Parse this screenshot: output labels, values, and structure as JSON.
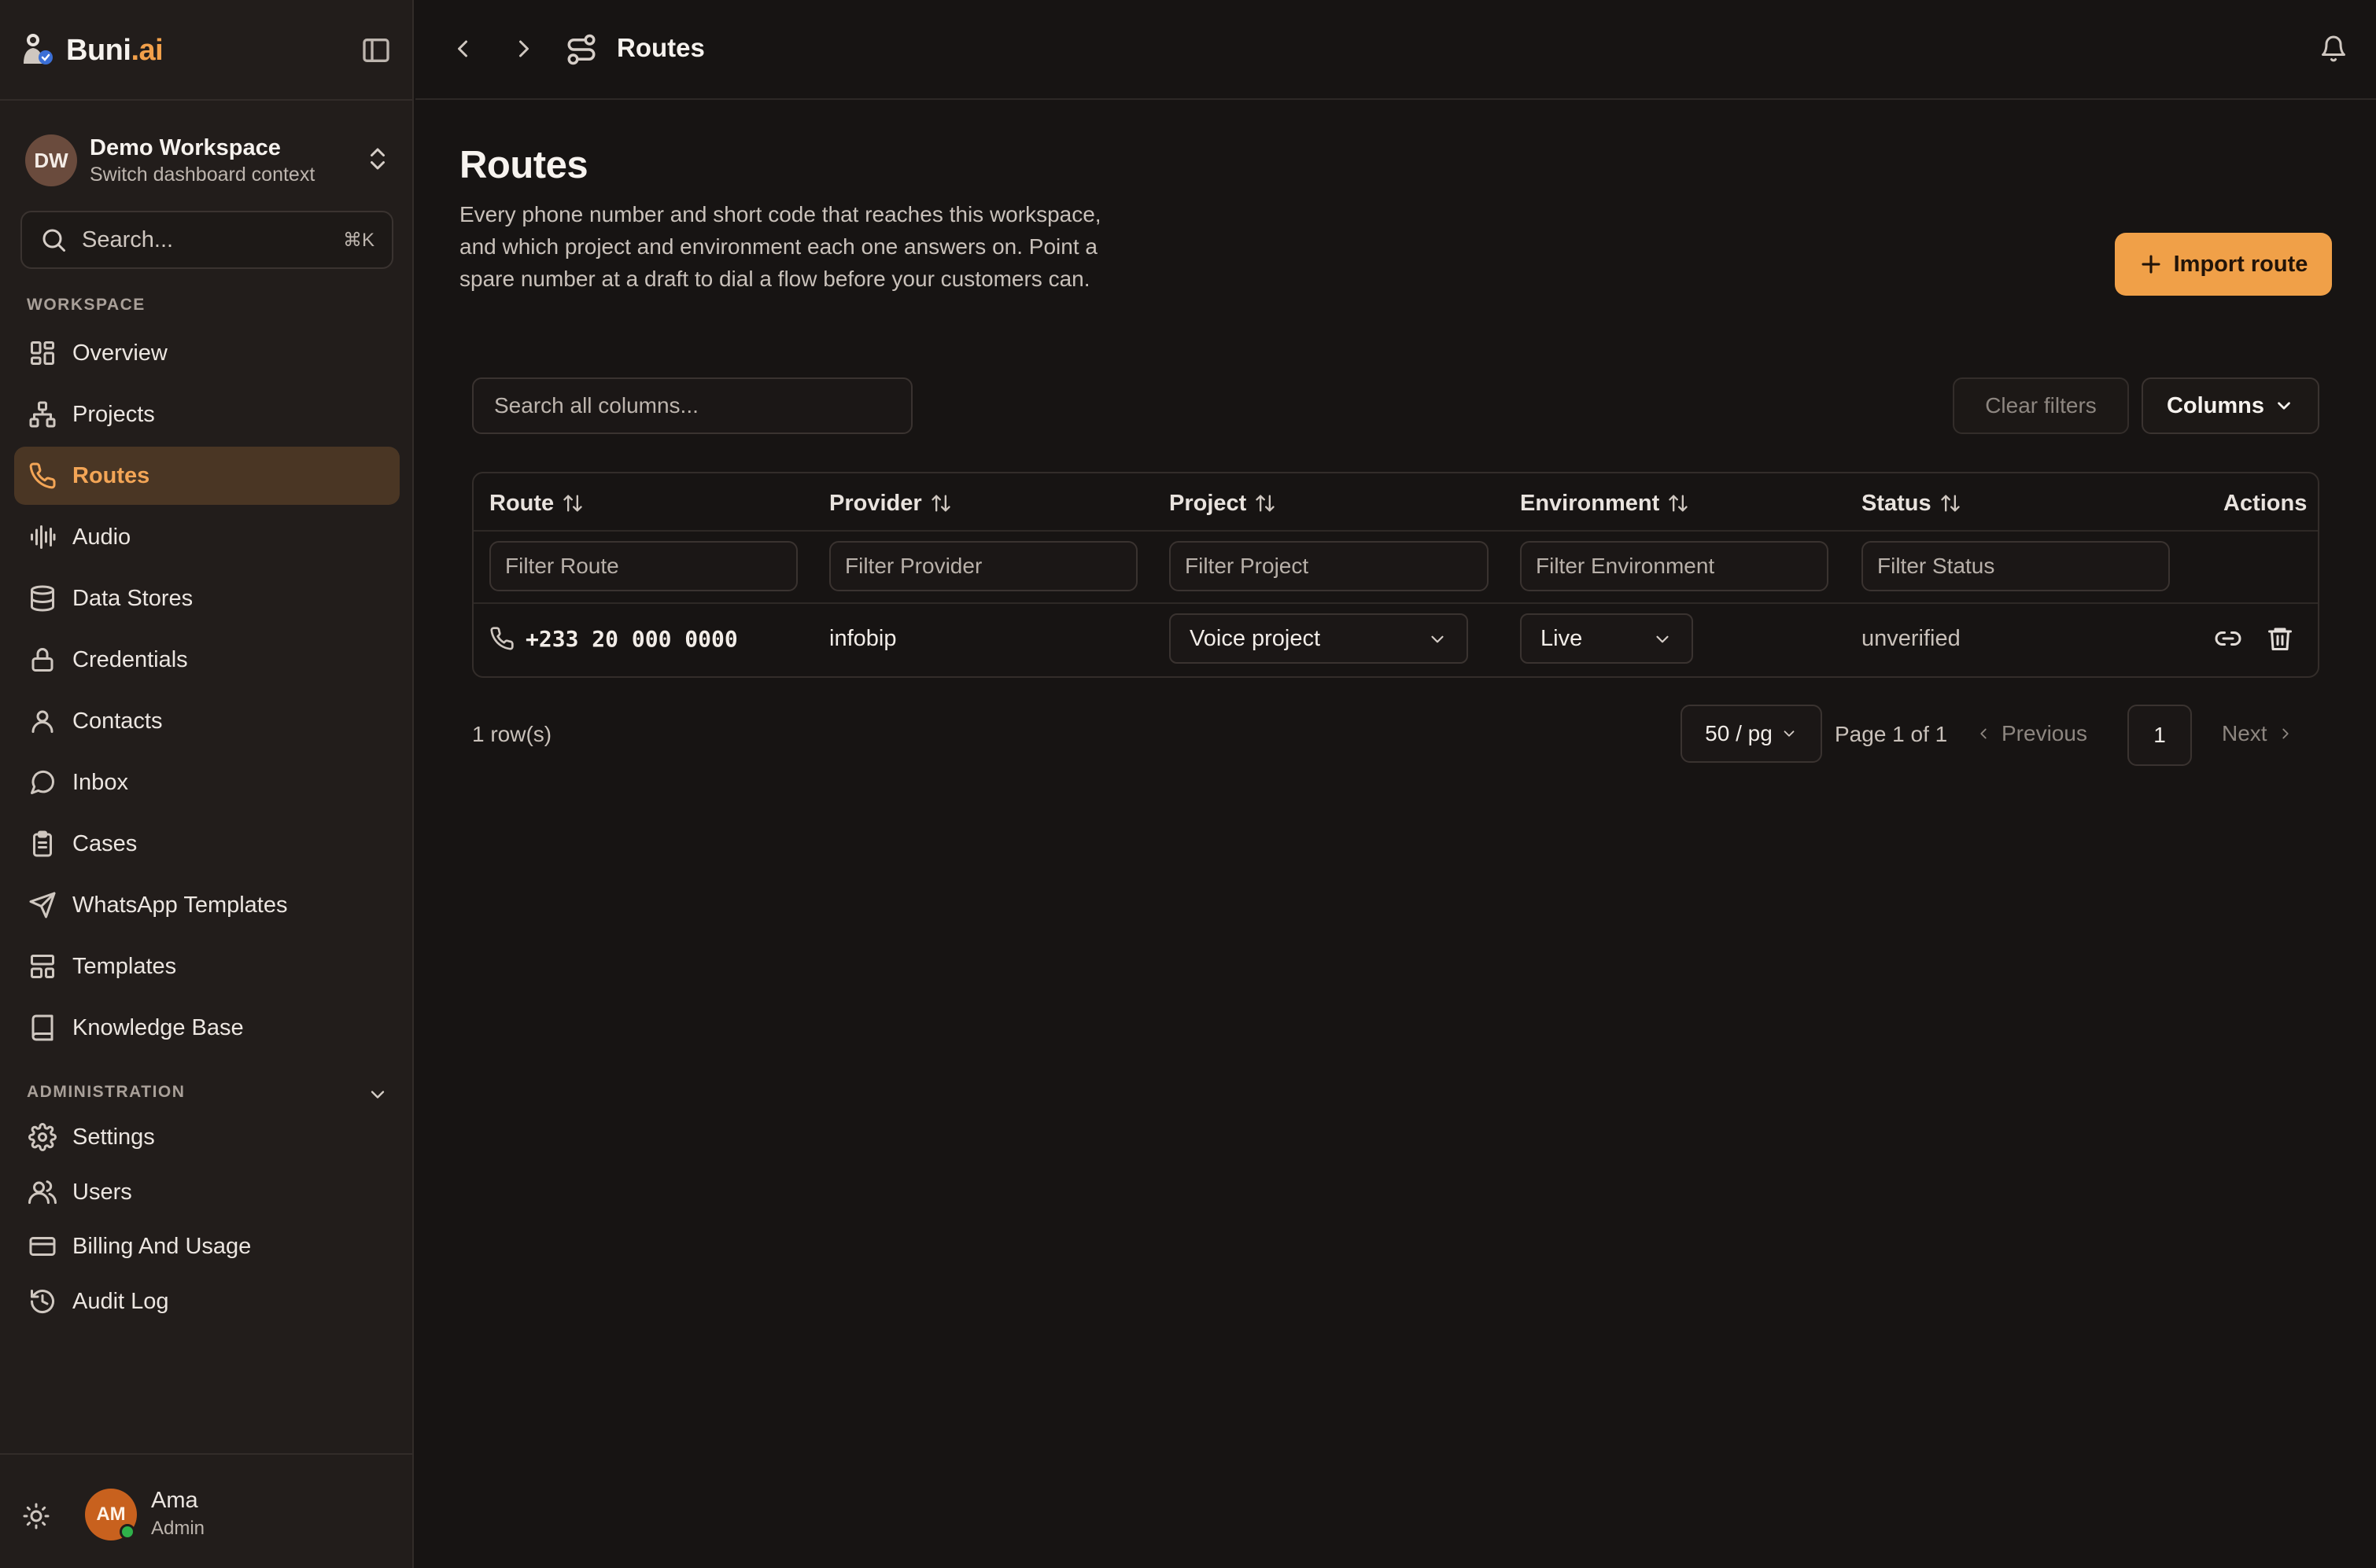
{
  "brand": {
    "name": "Buni",
    "suffix": ".ai"
  },
  "workspace": {
    "initials": "DW",
    "name": "Demo Workspace",
    "subtitle": "Switch dashboard context"
  },
  "sidebar_search": {
    "placeholder": "Search...",
    "shortcut": "⌘K"
  },
  "sections": {
    "workspace": "WORKSPACE",
    "administration": "ADMINISTRATION"
  },
  "nav": {
    "workspace_items": [
      {
        "label": "Overview",
        "icon": "grid-icon"
      },
      {
        "label": "Projects",
        "icon": "projects-icon"
      },
      {
        "label": "Routes",
        "icon": "phone-icon",
        "active": true
      },
      {
        "label": "Audio",
        "icon": "audio-waveform-icon"
      },
      {
        "label": "Data Stores",
        "icon": "database-icon"
      },
      {
        "label": "Credentials",
        "icon": "lock-icon"
      },
      {
        "label": "Contacts",
        "icon": "user-icon"
      },
      {
        "label": "Inbox",
        "icon": "chat-bubble-icon"
      },
      {
        "label": "Cases",
        "icon": "clipboard-icon"
      },
      {
        "label": "WhatsApp Templates",
        "icon": "send-icon"
      },
      {
        "label": "Templates",
        "icon": "layout-icon"
      },
      {
        "label": "Knowledge Base",
        "icon": "book-icon"
      }
    ],
    "admin_items": [
      {
        "label": "Settings",
        "icon": "gear-icon"
      },
      {
        "label": "Users",
        "icon": "users-icon"
      },
      {
        "label": "Billing And Usage",
        "icon": "credit-card-icon"
      },
      {
        "label": "Audit Log",
        "icon": "history-icon"
      }
    ]
  },
  "user": {
    "initials": "AM",
    "name": "Ama",
    "role": "Admin",
    "status_color": "#2fb14a"
  },
  "topbar": {
    "breadcrumb": "Routes"
  },
  "page": {
    "title": "Routes",
    "description_lines": [
      "Every phone number and short code that reaches this workspace,",
      "and which project and environment each one answers on. Point a",
      "spare number at a draft to dial a flow before your customers can."
    ],
    "import_button": "Import route"
  },
  "toolbar": {
    "search_placeholder": "Search all columns...",
    "clear_filters": "Clear filters",
    "columns": "Columns"
  },
  "table": {
    "headers": [
      "Route",
      "Provider",
      "Project",
      "Environment",
      "Status",
      "Actions"
    ],
    "filters": [
      "Filter Route",
      "Filter Provider",
      "Filter Project",
      "Filter Environment",
      "Filter Status"
    ],
    "rows": [
      {
        "route": "+233 20 000 0000",
        "provider": "infobip",
        "project": "Voice project",
        "environment": "Live",
        "status": "unverified"
      }
    ]
  },
  "pagination": {
    "row_count": "1 row(s)",
    "per_page": "50 / pg",
    "page_info": "Page 1 of 1",
    "previous": "Previous",
    "current_page": "1",
    "next": "Next"
  },
  "colors": {
    "accent": "#f0a048",
    "active_bg": "#4a3624",
    "background": "#171413",
    "sidebar": "#221d1b"
  }
}
